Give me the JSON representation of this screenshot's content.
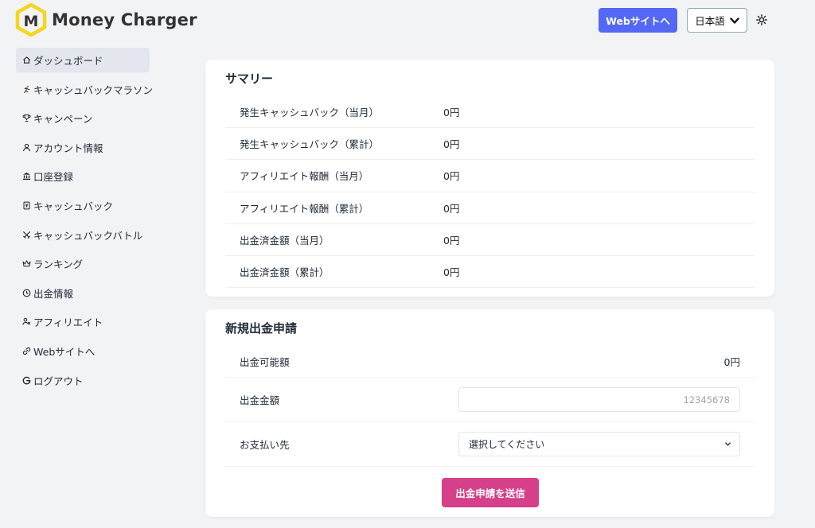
{
  "header": {
    "logo_text": "Money Charger",
    "logo_letter": "M",
    "website_button": "Webサイトへ",
    "language": "日本語",
    "colors": {
      "website_button": "#5468f5",
      "logo_yellow": "#f5d61e",
      "submit": "#d6408a"
    }
  },
  "sidebar": {
    "items": [
      {
        "label": "ダッシュボード",
        "icon": "home-icon"
      },
      {
        "label": "キャッシュバックマラソン",
        "icon": "runner-icon"
      },
      {
        "label": "キャンペーン",
        "icon": "trophy-icon"
      },
      {
        "label": "アカウント情報",
        "icon": "user-icon"
      },
      {
        "label": "口座登録",
        "icon": "bank-icon"
      },
      {
        "label": "キャッシュバック",
        "icon": "cashback-icon"
      },
      {
        "label": "キャッシュバックバトル",
        "icon": "battle-icon"
      },
      {
        "label": "ランキング",
        "icon": "crown-icon"
      },
      {
        "label": "出金情報",
        "icon": "clock-icon"
      },
      {
        "label": "アフィリエイト",
        "icon": "affiliate-icon"
      },
      {
        "label": "Webサイトへ",
        "icon": "link-icon"
      },
      {
        "label": "ログアウト",
        "icon": "logout-icon"
      }
    ]
  },
  "summary": {
    "title": "サマリー",
    "rows": [
      {
        "label": "発生キャッシュバック（当月）",
        "value": "0円"
      },
      {
        "label": "発生キャッシュバック（累計）",
        "value": "0円"
      },
      {
        "label": "アフィリエイト報酬（当月）",
        "value": "0円"
      },
      {
        "label": "アフィリエイト報酬（累計）",
        "value": "0円"
      },
      {
        "label": "出金済金額（当月）",
        "value": "0円"
      },
      {
        "label": "出金済金額（累計）",
        "value": "0円"
      }
    ]
  },
  "withdraw": {
    "title": "新規出金申請",
    "available_label": "出金可能額",
    "available_value": "0円",
    "amount_label": "出金金額",
    "amount_placeholder": "12345678",
    "payee_label": "お支払い先",
    "payee_selected": "選択してください",
    "submit_label": "出金申請を送信"
  }
}
